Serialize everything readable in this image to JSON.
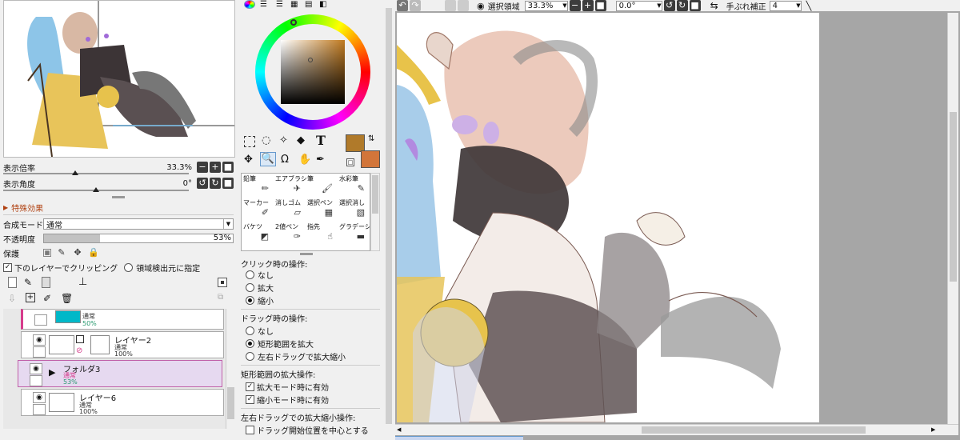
{
  "navigator": {
    "zoom_label": "表示倍率",
    "zoom_value": "33.3%",
    "angle_label": "表示角度",
    "angle_value": "0°"
  },
  "effects": {
    "title": "特殊効果"
  },
  "layer_props": {
    "blend_label": "合成モード",
    "blend_value": "通常",
    "opacity_label": "不透明度",
    "opacity_value": "53%",
    "opacity_fraction": 0.53,
    "protect_label": "保護",
    "clip_label": "下のレイヤーでクリッピング",
    "area_label": "領域検出元に指定"
  },
  "layers": [
    {
      "name": "",
      "mode": "通常",
      "opacity": "50%",
      "thumb_color": "#00b8c8"
    },
    {
      "name": "レイヤー2",
      "mode": "通常",
      "opacity": "100%"
    },
    {
      "name": "フォルダ3",
      "mode": "通常",
      "opacity": "53%"
    },
    {
      "name": "レイヤー6",
      "mode": "通常",
      "opacity": "100%"
    }
  ],
  "colors": {
    "primary": "#b07a2a",
    "secondary": "#d2753a",
    "accent_selection": "#e6d9f0",
    "accent_pink": "#d63c8c"
  },
  "tools": [
    {
      "label": "鉛筆",
      "icon": "pencil-icon"
    },
    {
      "label": "エアブラシ",
      "icon": "airbrush-icon"
    },
    {
      "label": "筆",
      "icon": "brush-icon"
    },
    {
      "label": "水彩筆",
      "icon": "watercolor-icon"
    },
    {
      "label": "マーカー",
      "icon": "marker-icon"
    },
    {
      "label": "消しゴム",
      "icon": "eraser-icon"
    },
    {
      "label": "選択ペン",
      "icon": "select-pen-icon"
    },
    {
      "label": "選択消し",
      "icon": "select-erase-icon"
    },
    {
      "label": "バケツ",
      "icon": "bucket-icon"
    },
    {
      "label": "2値ペン",
      "icon": "binary-pen-icon"
    },
    {
      "label": "指先",
      "icon": "finger-icon"
    },
    {
      "label": "グラデーション",
      "icon": "gradation-icon"
    }
  ],
  "zoom_options": {
    "click_title": "クリック時の操作:",
    "click_none": "なし",
    "click_zoom_in": "拡大",
    "click_zoom_out": "縮小",
    "drag_title": "ドラッグ時の操作:",
    "drag_none": "なし",
    "drag_rect": "矩形範囲を拡大",
    "drag_lr": "左右ドラッグで拡大縮小",
    "rect_title": "矩形範囲の拡大操作:",
    "rect_in": "拡大モード時に有効",
    "rect_out": "縮小モード時に有効",
    "lr_title": "左右ドラッグでの拡大縮小操作:",
    "lr_center": "ドラッグ開始位置を中心とする"
  },
  "toolbar": {
    "selection_label": "選択領域",
    "zoom_value": "33.3%",
    "angle_value": "0.0°",
    "stabilizer_label": "手ぶれ補正",
    "stabilizer_value": "4"
  }
}
